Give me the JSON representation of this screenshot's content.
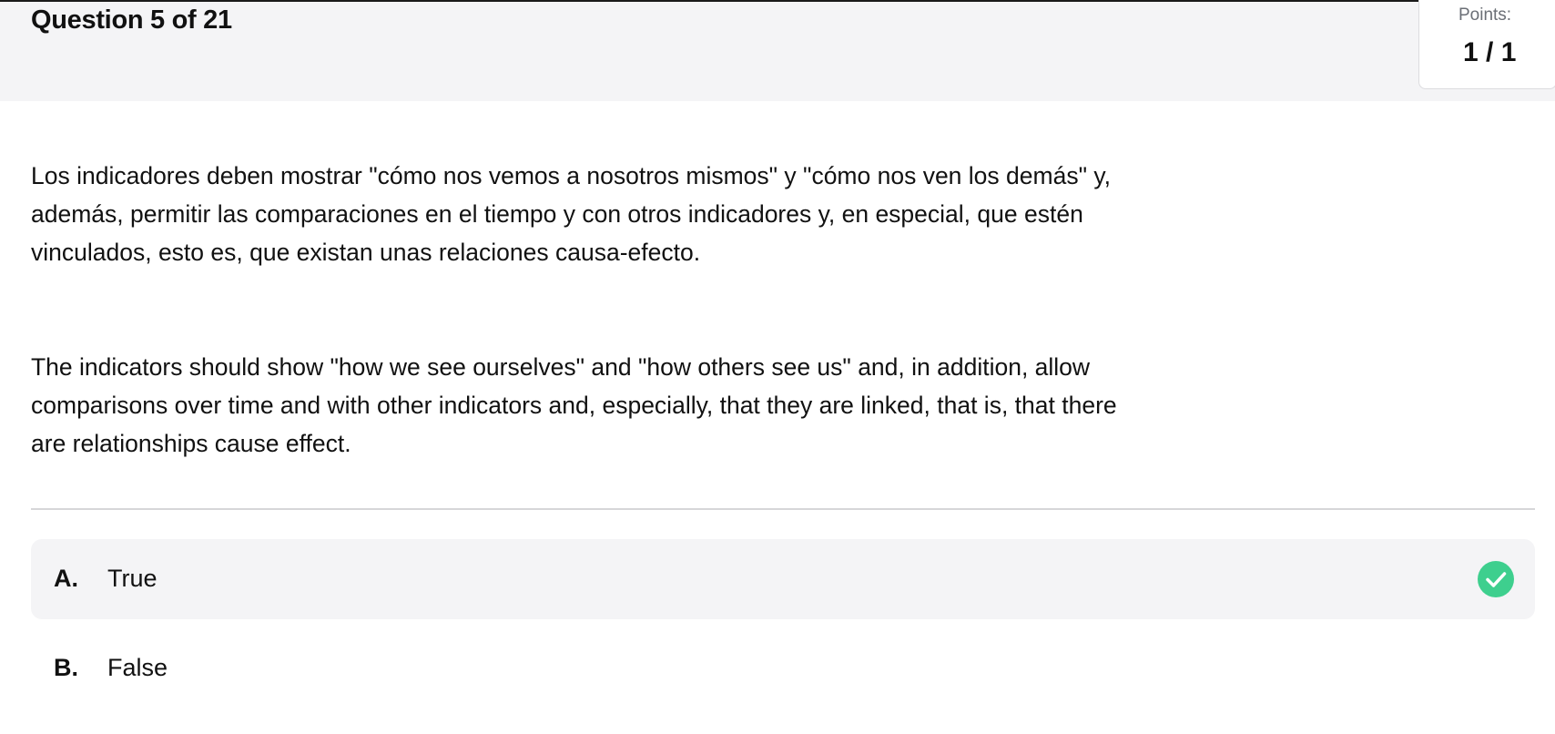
{
  "header": {
    "question_counter": "Question 5 of 21",
    "points_label": "Points:",
    "points_value": "1 / 1"
  },
  "question": {
    "paragraphs": [
      "Los indicadores deben mostrar \"cómo nos vemos a nosotros mismos\" y \"cómo nos ven los demás\" y, además, permitir las comparaciones en el tiempo y con otros indicadores y, en especial, que estén vinculados, esto es, que existan unas relaciones causa-efecto.",
      "The indicators should show \"how we see ourselves\" and \"how others see us\" and, in addition, allow comparisons over time and with other indicators and, especially, that they are linked, that is, that there are relationships cause effect."
    ]
  },
  "options": [
    {
      "letter": "A.",
      "text": "True",
      "selected": true,
      "status_icon": "check-circle-icon"
    },
    {
      "letter": "B.",
      "text": "False",
      "selected": false
    }
  ],
  "colors": {
    "correct": "#3ecf8e",
    "header_bg": "#f4f4f6",
    "selected_bg": "#f4f4f6"
  }
}
